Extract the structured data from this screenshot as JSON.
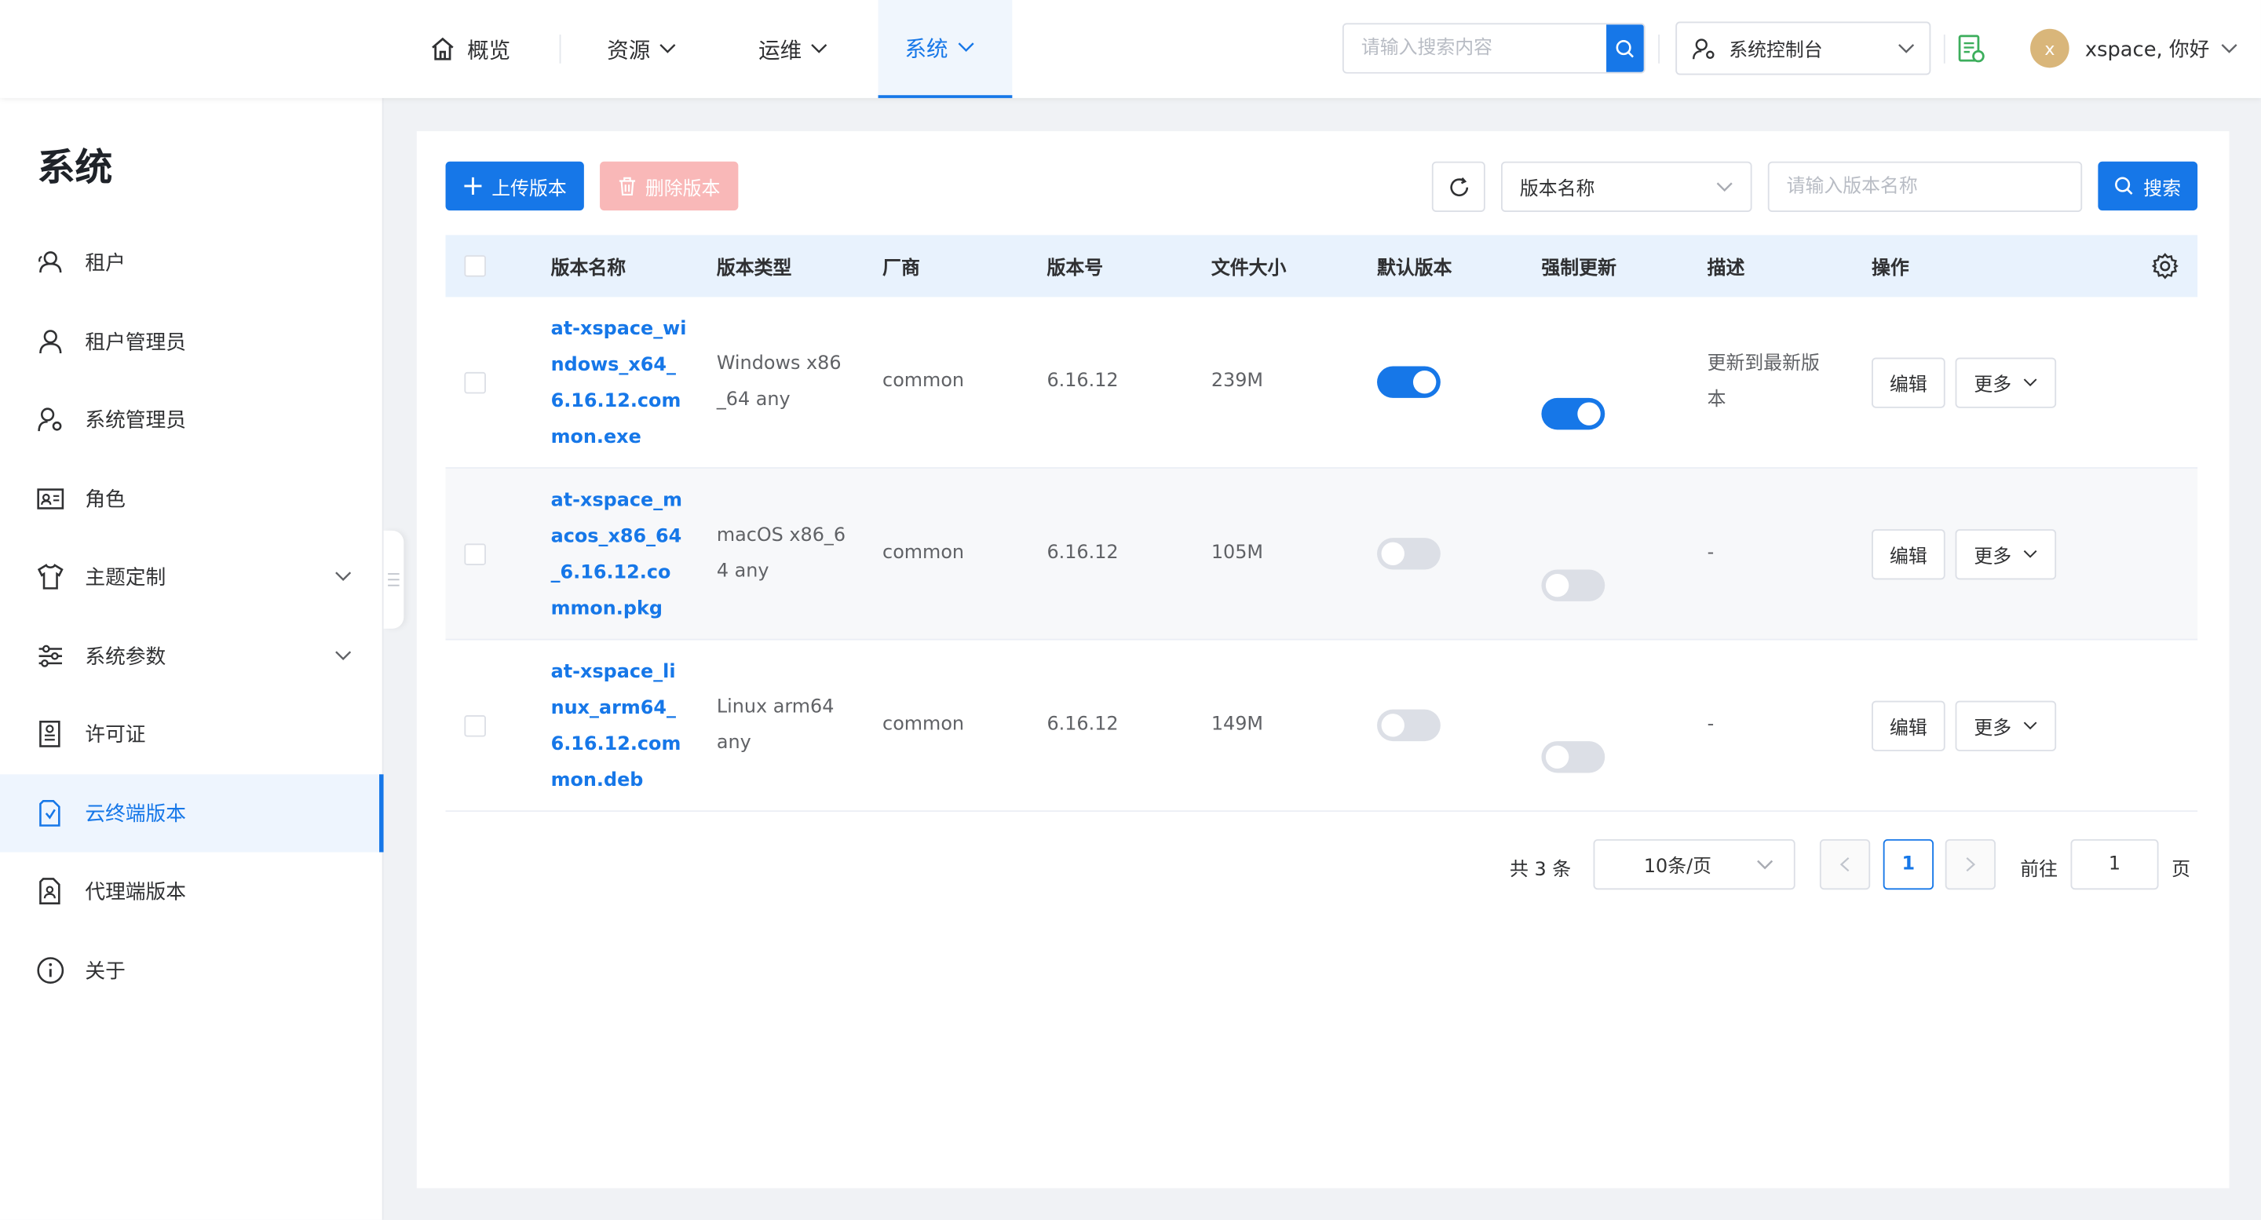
{
  "header": {
    "nav": [
      {
        "label": "概览",
        "icon": "home-icon"
      },
      {
        "label": "资源"
      },
      {
        "label": "运维"
      },
      {
        "label": "系统",
        "active": true
      }
    ],
    "search_placeholder": "请输入搜索内容",
    "console_label": "系统控制台",
    "avatar_letter": "x",
    "user_greeting": "xspace, 你好"
  },
  "sidebar": {
    "title": "系统",
    "items": [
      {
        "label": "租户",
        "icon": "users-icon"
      },
      {
        "label": "租户管理员",
        "icon": "user-icon"
      },
      {
        "label": "系统管理员",
        "icon": "user-gear-icon"
      },
      {
        "label": "角色",
        "icon": "id-card-icon"
      },
      {
        "label": "主题定制",
        "icon": "shirt-icon",
        "expandable": true
      },
      {
        "label": "系统参数",
        "icon": "sliders-icon",
        "expandable": true
      },
      {
        "label": "许可证",
        "icon": "certificate-icon"
      },
      {
        "label": "云终端版本",
        "icon": "file-check-icon",
        "active": true
      },
      {
        "label": "代理端版本",
        "icon": "file-agent-icon"
      },
      {
        "label": "关于",
        "icon": "info-icon"
      }
    ]
  },
  "toolbar": {
    "upload_label": "上传版本",
    "delete_label": "删除版本",
    "field_select": "版本名称",
    "filter_placeholder": "请输入版本名称",
    "search_label": "搜索"
  },
  "table": {
    "columns": [
      "版本名称",
      "版本类型",
      "厂商",
      "版本号",
      "文件大小",
      "默认版本",
      "强制更新",
      "描述",
      "操作"
    ],
    "rows": [
      {
        "name": "at-xspace_windows_x64_6.16.12.common.exe",
        "type": "Windows x86_64 any",
        "vendor": "common",
        "version": "6.16.12",
        "size": "239M",
        "default": true,
        "force": true,
        "desc": "更新到最新版本",
        "edit": "编辑",
        "more": "更多"
      },
      {
        "name": "at-xspace_macos_x86_64_6.16.12.common.pkg",
        "type": "macOS x86_64 any",
        "vendor": "common",
        "version": "6.16.12",
        "size": "105M",
        "default": false,
        "force": false,
        "desc": "-",
        "edit": "编辑",
        "more": "更多"
      },
      {
        "name": "at-xspace_linux_arm64_6.16.12.common.deb",
        "type": "Linux arm64 any",
        "vendor": "common",
        "version": "6.16.12",
        "size": "149M",
        "default": false,
        "force": false,
        "desc": "-",
        "edit": "编辑",
        "more": "更多"
      }
    ]
  },
  "pagination": {
    "total_text": "共 3 条",
    "page_size": "10条/页",
    "current_page": "1",
    "goto_label": "前往",
    "goto_value": "1",
    "page_suffix": "页"
  },
  "colors": {
    "accent": "#1677e8",
    "danger_disabled": "#f9b8b8"
  }
}
